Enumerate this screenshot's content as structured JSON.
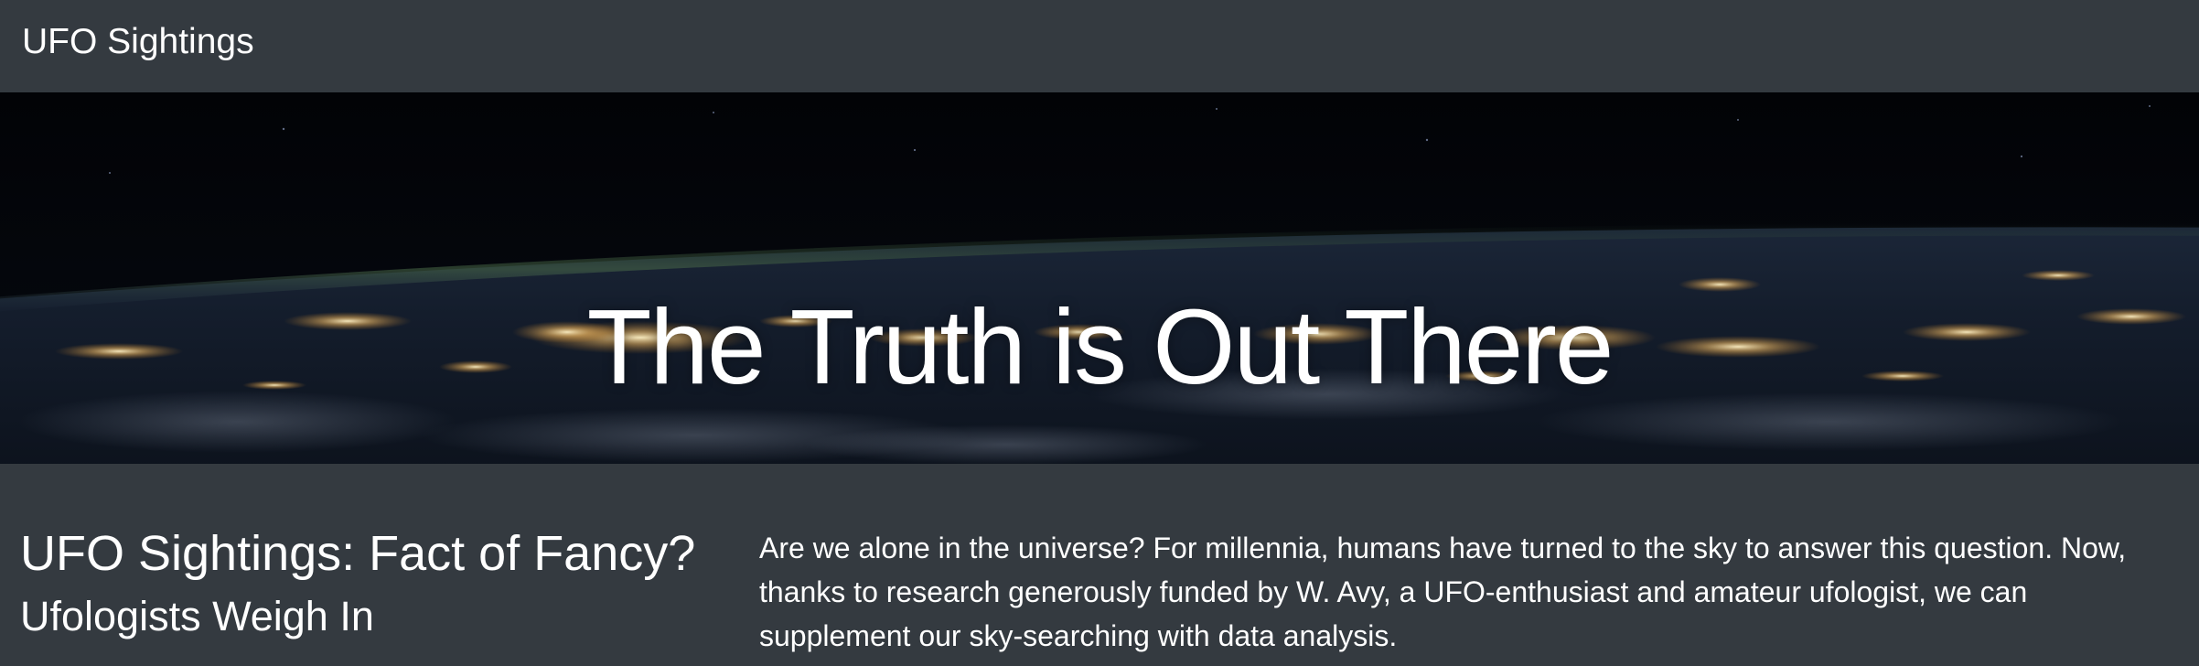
{
  "navbar": {
    "brand": "UFO Sightings"
  },
  "hero": {
    "title": "The Truth is Out There",
    "image": "earth-at-night-from-space"
  },
  "article": {
    "title": "UFO Sightings: Fact of Fancy?",
    "subtitle": "Ufologists Weigh In",
    "intro": "Are we alone in the universe? For millennia, humans have turned to the sky to answer this question. Now, thanks to research generously funded by W. Avy, a UFO-enthusiast and amateur ufologist, we can supplement our sky-searching with data analysis."
  },
  "colors": {
    "navbar_bg": "#343a40",
    "text": "#ffffff",
    "hero_space": "#000000",
    "city_lights": "#ffd27a"
  }
}
